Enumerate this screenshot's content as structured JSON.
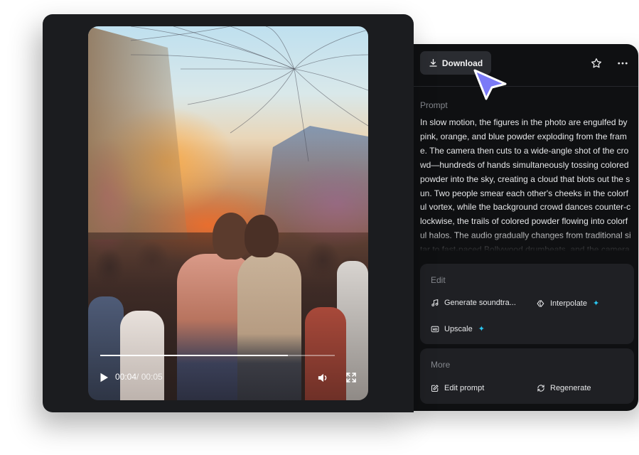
{
  "video": {
    "current_time": "00:04",
    "duration": "/ 00:05",
    "progress": 0.8
  },
  "toolbar": {
    "download_label": "Download",
    "favorite_icon": "star-icon",
    "more_icon": "more-horizontal-icon"
  },
  "prompt": {
    "label": "Prompt",
    "text": "In slow motion, the figures in the photo are engulfed by pink, orange, and blue powder exploding from the frame. The camera then cuts to a wide-angle shot of the crowd—hundreds of hands simultaneously tossing colored powder into the sky, creating a cloud that blots out the sun. Two people smear each other's cheeks in the colorful vortex, while the background crowd dances counter-clockwise, the trails of colored powder flowing into colorful halos. The audio gradually changes from traditional sitar to fast-paced Bollywood drumbeats, and the camera ap"
  },
  "edit": {
    "title": "Edit",
    "items": [
      {
        "label": "Generate soundtra...",
        "icon": "music-note-icon",
        "badge": ""
      },
      {
        "label": "Interpolate",
        "icon": "interpolate-icon",
        "badge": "✦"
      },
      {
        "label": "Upscale",
        "icon": "hd-icon",
        "badge": "✦"
      }
    ]
  },
  "more": {
    "title": "More",
    "items": [
      {
        "label": "Edit prompt",
        "icon": "edit-icon"
      },
      {
        "label": "Regenerate",
        "icon": "regenerate-icon"
      }
    ]
  },
  "colors": {
    "panel_bg": "#0f1012",
    "card_bg": "#1f2024",
    "accent_sparkle": "#29c7f2",
    "cursor": "#6e6cf5"
  }
}
